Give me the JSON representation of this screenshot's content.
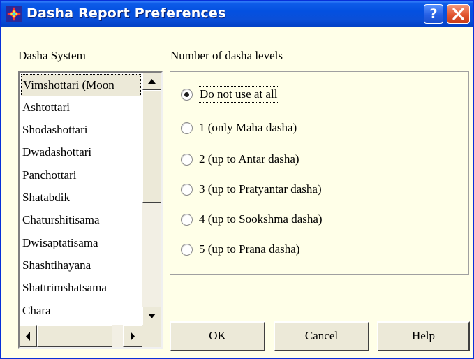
{
  "window": {
    "title": "Dasha Report Preferences",
    "help_button_label": "?"
  },
  "dasha_system": {
    "label": "Dasha System",
    "items": [
      "Vimshottari (Moon",
      "Ashtottari",
      "Shodashottari",
      "Dwadashottari",
      "Panchottari",
      "Shatabdik",
      "Chaturshitisama",
      "Dwisaptatisama",
      "Shashtihayana",
      "Shattrimshatsama",
      "Chara",
      "Yogini"
    ],
    "selected_index": 0
  },
  "levels": {
    "label": "Number of dasha levels",
    "options": [
      "Do not use at all",
      "1 (only Maha dasha)",
      "2 (up to Antar dasha)",
      "3 (up to Pratyantar dasha)",
      "4 (up to Sookshma dasha)",
      "5 (up to Prana dasha)"
    ],
    "selected_index": 0
  },
  "buttons": {
    "ok": "OK",
    "cancel": "Cancel",
    "help": "Help"
  },
  "colors": {
    "titlebar": "#0450e0",
    "dialog_background": "#ffffe8",
    "close_button": "#e2552f"
  }
}
